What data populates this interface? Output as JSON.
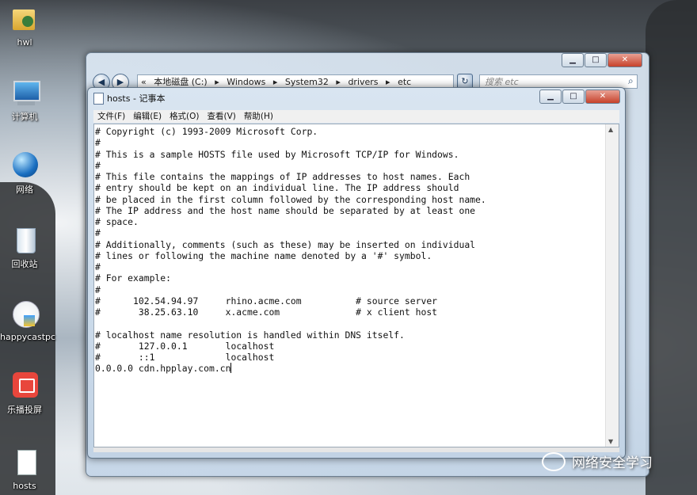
{
  "desktop": {
    "icons": [
      {
        "label": "hwl",
        "icon": "user-folder-icon"
      },
      {
        "label": "计算机",
        "icon": "computer-icon"
      },
      {
        "label": "网络",
        "icon": "network-globe-icon"
      },
      {
        "label": "回收站",
        "icon": "recycle-bin-icon"
      },
      {
        "label": "happycastpc",
        "icon": "happycast-icon"
      },
      {
        "label": "乐播投屏",
        "icon": "lebo-cast-icon"
      },
      {
        "label": "hosts",
        "icon": "file-icon"
      }
    ]
  },
  "explorer": {
    "path": [
      "«",
      "本地磁盘 (C:)",
      "▸",
      "Windows",
      "▸",
      "System32",
      "▸",
      "drivers",
      "▸",
      "etc"
    ],
    "search_placeholder": "搜索 etc"
  },
  "notepad": {
    "title": "hosts - 记事本",
    "menu": [
      "文件(F)",
      "编辑(E)",
      "格式(O)",
      "查看(V)",
      "帮助(H)"
    ],
    "content": "# Copyright (c) 1993-2009 Microsoft Corp.\n#\n# This is a sample HOSTS file used by Microsoft TCP/IP for Windows.\n#\n# This file contains the mappings of IP addresses to host names. Each\n# entry should be kept on an individual line. The IP address should\n# be placed in the first column followed by the corresponding host name.\n# The IP address and the host name should be separated by at least one\n# space.\n#\n# Additionally, comments (such as these) may be inserted on individual\n# lines or following the machine name denoted by a '#' symbol.\n#\n# For example:\n#\n#      102.54.94.97     rhino.acme.com          # source server\n#       38.25.63.10     x.acme.com              # x client host\n\n# localhost name resolution is handled within DNS itself.\n#\t127.0.0.1       localhost\n#\t::1             localhost\n0.0.0.0 cdn.hpplay.com.cn"
  },
  "watermark": "网络安全学习"
}
